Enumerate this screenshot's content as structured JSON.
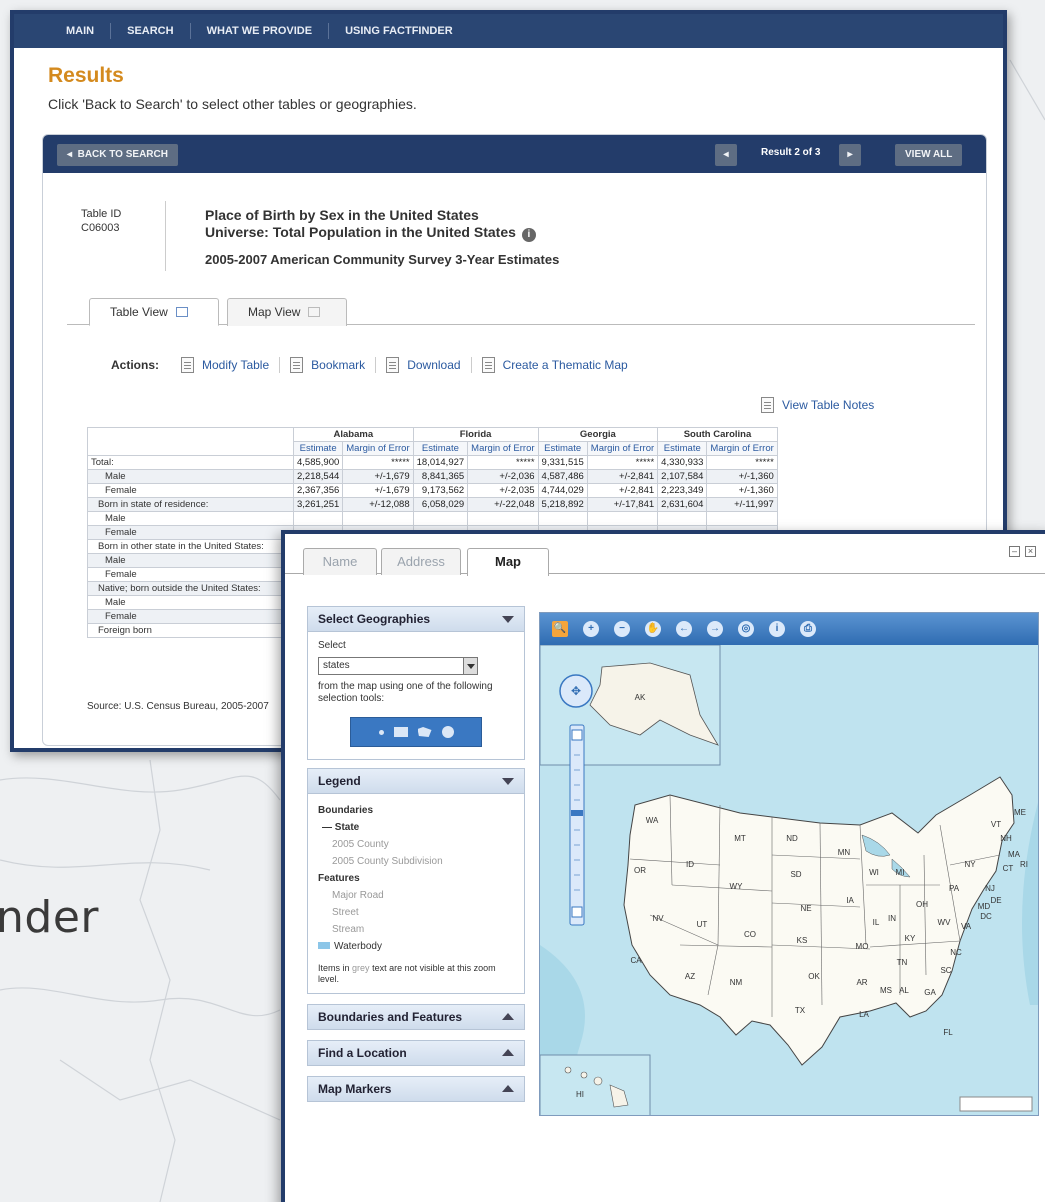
{
  "background_text": "nder",
  "nav": [
    "MAIN",
    "SEARCH",
    "WHAT WE PROVIDE",
    "USING FACTFINDER"
  ],
  "results": {
    "title": "Results",
    "subtitle": "Click 'Back to Search' to select other tables or geographies."
  },
  "toolbar": {
    "back": "BACK TO SEARCH",
    "result_count": "Result 2 of 3",
    "view_all": "VIEW ALL"
  },
  "table_info": {
    "id_label": "Table ID",
    "id_value": "C06003",
    "title": "Place of Birth by Sex in the United States",
    "universe": "Universe: Total Population in the United States",
    "survey": "2005-2007 American Community Survey 3-Year Estimates"
  },
  "view_tabs": [
    "Table View",
    "Map View"
  ],
  "actions": {
    "label": "Actions:",
    "items": [
      "Modify Table",
      "Bookmark",
      "Download",
      "Create a Thematic Map"
    ],
    "notes": "View Table Notes"
  },
  "table": {
    "states": [
      "Alabama",
      "Florida",
      "Georgia",
      "South Carolina"
    ],
    "subheaders": [
      "Estimate",
      "Margin of Error"
    ],
    "rows": [
      {
        "label": "Total:",
        "indent": 0,
        "cells": [
          "4,585,900",
          "*****",
          "18,014,927",
          "*****",
          "9,331,515",
          "*****",
          "4,330,933",
          "*****"
        ]
      },
      {
        "label": "Male",
        "indent": 2,
        "cells": [
          "2,218,544",
          "+/-1,679",
          "8,841,365",
          "+/-2,036",
          "4,587,486",
          "+/-2,841",
          "2,107,584",
          "+/-1,360"
        ]
      },
      {
        "label": "Female",
        "indent": 2,
        "cells": [
          "2,367,356",
          "+/-1,679",
          "9,173,562",
          "+/-2,035",
          "4,744,029",
          "+/-2,841",
          "2,223,349",
          "+/-1,360"
        ]
      },
      {
        "label": "Born in state of residence:",
        "indent": 1,
        "cells": [
          "3,261,251",
          "+/-12,088",
          "6,058,029",
          "+/-22,048",
          "5,218,892",
          "+/-17,841",
          "2,631,604",
          "+/-11,997"
        ]
      },
      {
        "label": "Male",
        "indent": 2,
        "cells": []
      },
      {
        "label": "Female",
        "indent": 2,
        "cells": []
      },
      {
        "label": "Born in other state in the United States:",
        "indent": 1,
        "cells": []
      },
      {
        "label": "Male",
        "indent": 2,
        "cells": []
      },
      {
        "label": "Female",
        "indent": 2,
        "cells": []
      },
      {
        "label": "Native; born outside the United States:",
        "indent": 1,
        "cells": []
      },
      {
        "label": "Male",
        "indent": 2,
        "cells": []
      },
      {
        "label": "Female",
        "indent": 2,
        "cells": []
      },
      {
        "label": "Foreign born",
        "indent": 1,
        "cells": []
      }
    ],
    "source": "Source: U.S. Census Bureau, 2005-2007"
  },
  "map_window": {
    "tabs": [
      "Name",
      "Address",
      "Map"
    ],
    "select_geographies": {
      "header": "Select Geographies",
      "select_label": "Select",
      "select_value": "states",
      "instructions": "from the map using one of the following selection tools:"
    },
    "legend": {
      "header": "Legend",
      "boundaries_label": "Boundaries",
      "state_item": "— State",
      "grey_boundaries": [
        "2005 County",
        "2005 County Subdivision"
      ],
      "features_label": "Features",
      "grey_features": [
        "Major Road",
        "Street",
        "Stream"
      ],
      "waterbody": "Waterbody",
      "note_prefix": "Items in",
      "note_grey": "grey",
      "note_suffix": "text are not visible at this zoom level."
    },
    "panels": [
      "Boundaries and Features",
      "Find a Location",
      "Map Markers"
    ],
    "state_labels": [
      "AK",
      "HI",
      "WA",
      "OR",
      "ID",
      "MT",
      "ND",
      "SD",
      "MN",
      "WY",
      "NV",
      "UT",
      "CO",
      "NE",
      "KS",
      "CA",
      "AZ",
      "NM",
      "TX",
      "OK",
      "IA",
      "IL",
      "MO",
      "AR",
      "LA",
      "MS",
      "AL",
      "GA",
      "FL",
      "SC",
      "NC",
      "TN",
      "KY",
      "IN",
      "OH",
      "MI",
      "WI",
      "PA",
      "NY",
      "VT",
      "NH",
      "ME",
      "MA",
      "CT",
      "NJ",
      "DE",
      "MD",
      "WV",
      "VA",
      "DC",
      "RI"
    ],
    "colors": {
      "window_border": "#233c6a",
      "accent": "#d48a1e",
      "water": "#bfe3ef",
      "land": "#fbfaf3"
    }
  }
}
